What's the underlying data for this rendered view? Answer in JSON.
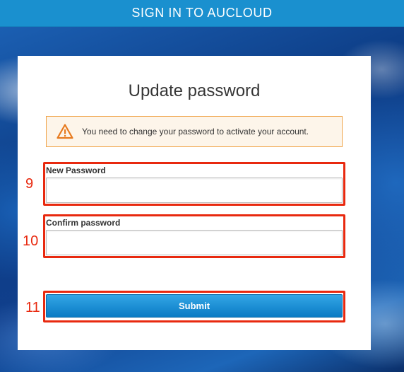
{
  "header": {
    "title": "SIGN IN TO AUCLOUD"
  },
  "form": {
    "heading": "Update password",
    "alert": {
      "icon": "warning-icon",
      "message": "You need to change your password to activate your account."
    },
    "new_password": {
      "label": "New Password",
      "value": ""
    },
    "confirm_password": {
      "label": "Confirm password",
      "value": ""
    },
    "submit_label": "Submit"
  },
  "annotations": [
    {
      "number": "9"
    },
    {
      "number": "10"
    },
    {
      "number": "11"
    }
  ],
  "colors": {
    "header_bg": "#1a90cf",
    "button_bg": "#1286cf",
    "alert_border": "#f0a44a",
    "warning_icon": "#e77a1e",
    "callout": "#e8290f"
  }
}
